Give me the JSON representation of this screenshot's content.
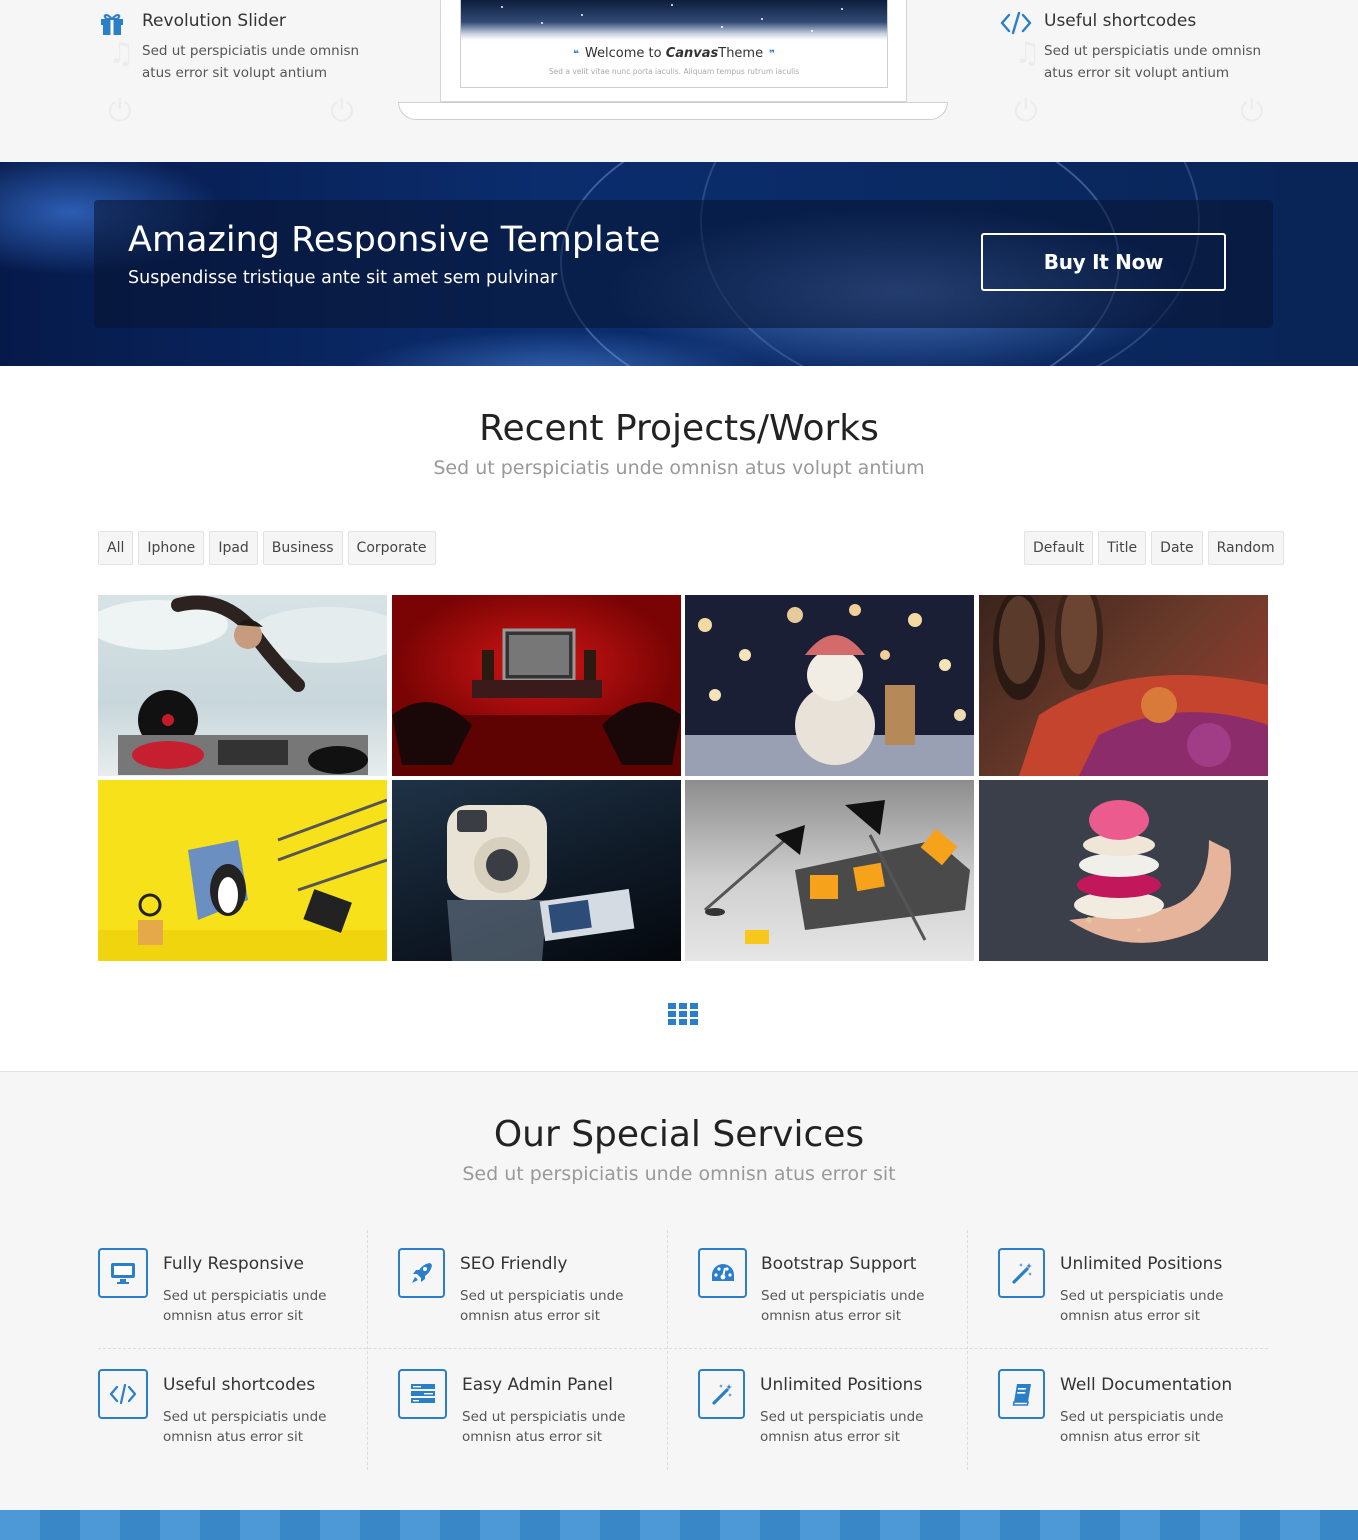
{
  "features": {
    "left": {
      "icon": "gift-icon",
      "title": "Revolution Slider",
      "text": "Sed ut perspiciatis unde omnisn atus error sit volupt antium"
    },
    "right": {
      "icon": "code-icon",
      "title": "Useful shortcodes",
      "text": "Sed ut perspiciatis unde omnisn atus error sit volupt antium"
    },
    "laptop": {
      "welcome_pre": "Welcome to",
      "welcome_brand": "Canvas",
      "welcome_post": "Theme",
      "sub": "Sed a velit vitae nunc porta iaculis. Aliquam tempus rutrum iaculis"
    }
  },
  "promo": {
    "title": "Amazing Responsive Template",
    "subtitle": "Suspendisse tristique ante sit amet sem pulvinar",
    "button": "Buy It Now"
  },
  "projects": {
    "title": "Recent Projects/Works",
    "subtitle": "Sed ut perspiciatis unde omnisn atus volupt antium",
    "filters": [
      "All",
      "Iphone",
      "Ipad",
      "Business",
      "Corporate"
    ],
    "sorts": [
      "Default",
      "Title",
      "Date",
      "Random"
    ],
    "grid_icon": "grid-icon"
  },
  "services": {
    "title": "Our Special Services",
    "subtitle": "Sed ut perspiciatis unde omnisn atus error sit",
    "items": [
      {
        "icon": "monitor-icon",
        "title": "Fully Responsive",
        "text": "Sed ut perspiciatis unde omnisn atus error sit"
      },
      {
        "icon": "rocket-icon",
        "title": "SEO Friendly",
        "text": "Sed ut perspiciatis unde omnisn atus error sit"
      },
      {
        "icon": "dashboard-icon",
        "title": "Bootstrap Support",
        "text": "Sed ut perspiciatis unde omnisn atus error sit"
      },
      {
        "icon": "magic-wand-icon",
        "title": "Unlimited Positions",
        "text": "Sed ut perspiciatis unde omnisn atus error sit"
      },
      {
        "icon": "code-icon",
        "title": "Useful shortcodes",
        "text": "Sed ut perspiciatis unde omnisn atus error sit"
      },
      {
        "icon": "list-icon",
        "title": "Easy Admin Panel",
        "text": "Sed ut perspiciatis unde omnisn atus error sit"
      },
      {
        "icon": "magic-wand-icon",
        "title": "Unlimited Positions",
        "text": "Sed ut perspiciatis unde omnisn atus error sit"
      },
      {
        "icon": "book-icon",
        "title": "Well Documentation",
        "text": "Sed ut perspiciatis unde omnisn atus error sit"
      }
    ]
  },
  "colors": {
    "accent": "#2b7fc9",
    "banner": "#0b2d6d",
    "muted": "#999999"
  }
}
